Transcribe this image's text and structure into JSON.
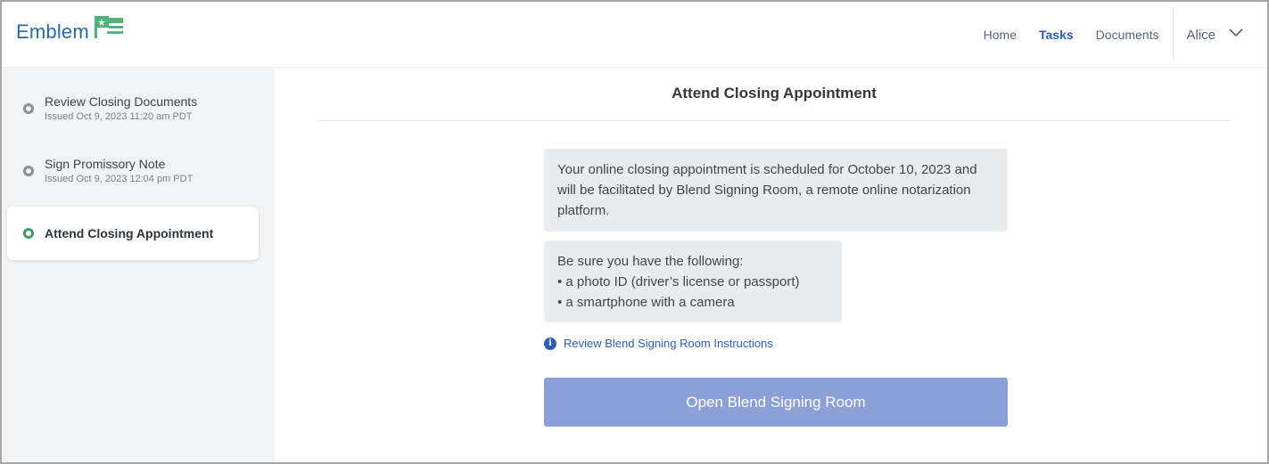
{
  "brand": {
    "name": "Emblem",
    "flag_icon": "flag-icon"
  },
  "nav": {
    "items": [
      {
        "label": "Home",
        "active": false
      },
      {
        "label": "Tasks",
        "active": true
      },
      {
        "label": "Documents",
        "active": false
      }
    ],
    "user": {
      "name": "Alice",
      "icon": "chevron-down-icon"
    }
  },
  "sidebar": {
    "steps": [
      {
        "title": "Review Closing Documents",
        "subtitle": "Issued Oct 9, 2023 11:20 am PDT",
        "status": "complete"
      },
      {
        "title": "Sign Promissory Note",
        "subtitle": "Issued Oct 9, 2023 12:04 pm PDT",
        "status": "complete"
      },
      {
        "title": "Attend Closing Appointment",
        "subtitle": "",
        "status": "current"
      }
    ]
  },
  "main": {
    "title": "Attend Closing Appointment",
    "appointment_text": "Your online closing appointment is scheduled for October 10, 2023 and will be facilitated by Blend Signing Room, a remote online notarization platform.",
    "requirements": {
      "intro": "Be sure you have the following:",
      "items": [
        "• a photo ID (driver’s license or passport)",
        "• a smartphone with a camera"
      ]
    },
    "instructions_link": {
      "label": "Review Blend Signing Room Instructions",
      "icon": "info-icon"
    },
    "open_button": "Open Blend Signing Room"
  },
  "colors": {
    "brand_blue": "#2a6aa6",
    "brand_green": "#4fb37a",
    "active_nav": "#2e5fb8",
    "current_step": "#3f9a66",
    "button_disabled": "#8c9fd6",
    "sidebar_bg": "#f2f3f4",
    "card_bg": "#e9ecef"
  }
}
